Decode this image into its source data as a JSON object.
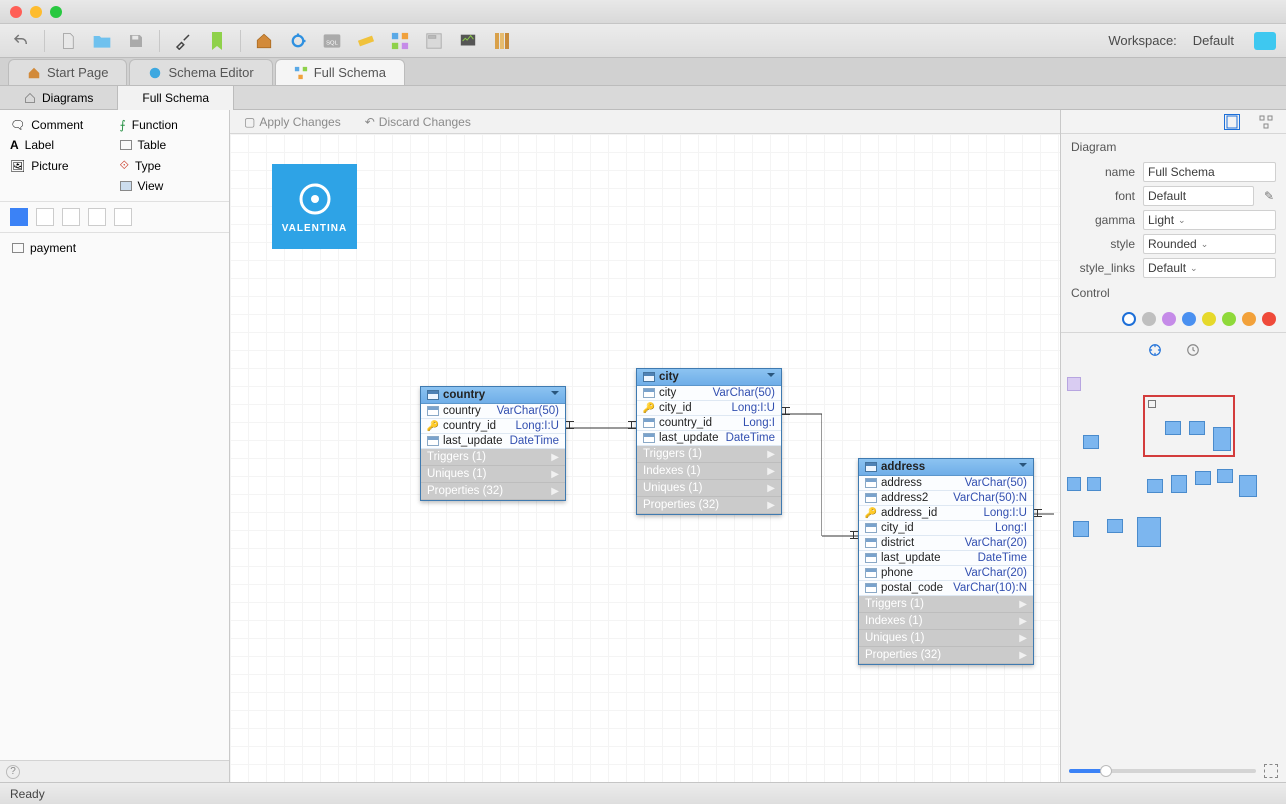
{
  "toolbar": {
    "workspace_label": "Workspace:",
    "workspace_value": "Default"
  },
  "tabs": [
    {
      "label": "Start Page",
      "icon": "home-icon",
      "active": false
    },
    {
      "label": "Schema Editor",
      "icon": "schema-icon",
      "active": false
    },
    {
      "label": "Full Schema",
      "icon": "diagram-icon",
      "active": true
    }
  ],
  "subtabs": [
    {
      "label": "Diagrams",
      "active": false
    },
    {
      "label": "Full Schema",
      "active": true
    }
  ],
  "palette": [
    {
      "label": "Comment",
      "icon": "comment-icon"
    },
    {
      "label": "Function",
      "icon": "function-icon"
    },
    {
      "label": "Label",
      "icon": "label-icon"
    },
    {
      "label": "Table",
      "icon": "table-icon"
    },
    {
      "label": "Picture",
      "icon": "picture-icon"
    },
    {
      "label": "Type",
      "icon": "type-icon"
    },
    {
      "label": "",
      "icon": ""
    },
    {
      "label": "View",
      "icon": "view-icon"
    }
  ],
  "tree": [
    {
      "label": "payment",
      "icon": "table-icon"
    }
  ],
  "canvasToolbar": {
    "apply": "Apply Changes",
    "discard": "Discard Changes"
  },
  "logo_text": "VALENTINA",
  "cards": {
    "country": {
      "title": "country",
      "rows": [
        {
          "icon": "col",
          "name": "country",
          "type": "VarChar(50)"
        },
        {
          "icon": "key",
          "name": "country_id",
          "type": "Long:I:U"
        },
        {
          "icon": "col",
          "name": "last_update",
          "type": "DateTime"
        }
      ],
      "secs": [
        {
          "label": "Triggers (1)"
        },
        {
          "label": "Uniques (1)"
        },
        {
          "label": "Properties (32)"
        }
      ]
    },
    "city": {
      "title": "city",
      "rows": [
        {
          "icon": "col",
          "name": "city",
          "type": "VarChar(50)"
        },
        {
          "icon": "key",
          "name": "city_id",
          "type": "Long:I:U"
        },
        {
          "icon": "col",
          "name": "country_id",
          "type": "Long:I"
        },
        {
          "icon": "col",
          "name": "last_update",
          "type": "DateTime"
        }
      ],
      "secs": [
        {
          "label": "Triggers (1)"
        },
        {
          "label": "Indexes (1)"
        },
        {
          "label": "Uniques (1)"
        },
        {
          "label": "Properties (32)"
        }
      ]
    },
    "address": {
      "title": "address",
      "rows": [
        {
          "icon": "col",
          "name": "address",
          "type": "VarChar(50)"
        },
        {
          "icon": "col",
          "name": "address2",
          "type": "VarChar(50):N"
        },
        {
          "icon": "key",
          "name": "address_id",
          "type": "Long:I:U"
        },
        {
          "icon": "col",
          "name": "city_id",
          "type": "Long:I"
        },
        {
          "icon": "col",
          "name": "district",
          "type": "VarChar(20)"
        },
        {
          "icon": "col",
          "name": "last_update",
          "type": "DateTime"
        },
        {
          "icon": "col",
          "name": "phone",
          "type": "VarChar(20)"
        },
        {
          "icon": "col",
          "name": "postal_code",
          "type": "VarChar(10):N"
        }
      ],
      "secs": [
        {
          "label": "Triggers (1)"
        },
        {
          "label": "Indexes (1)"
        },
        {
          "label": "Uniques (1)"
        },
        {
          "label": "Properties (32)"
        }
      ]
    }
  },
  "properties": {
    "section1": "Diagram",
    "name_label": "name",
    "name_value": "Full Schema",
    "font_label": "font",
    "font_value": "Default",
    "gamma_label": "gamma",
    "gamma_value": "Light",
    "style_label": "style",
    "style_value": "Rounded",
    "slinks_label": "style_links",
    "slinks_value": "Default",
    "section2": "Control",
    "colors": [
      "#ffffff",
      "#bfbfbf",
      "#c58be8",
      "#4a90f0",
      "#e6d92b",
      "#8fd93a",
      "#f2a13a",
      "#ef4a3a"
    ]
  },
  "status": "Ready"
}
